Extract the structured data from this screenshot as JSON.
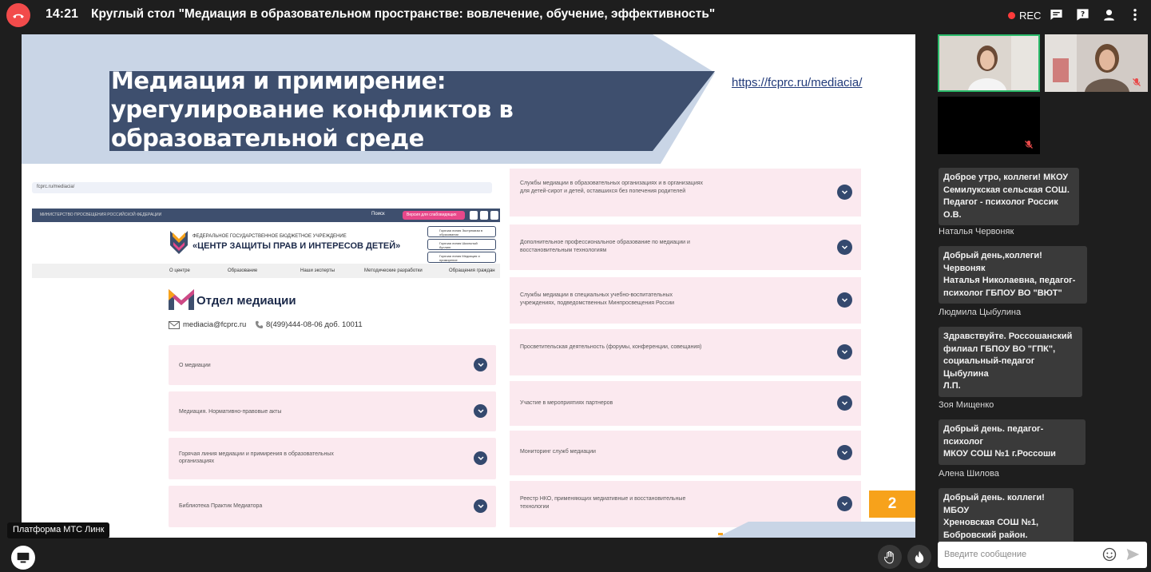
{
  "header": {
    "time": "14:21",
    "title": "Круглый стол \"Медиация в образовательном пространстве: вовлечение, обучение, эффективность\"",
    "rec_label": "REC"
  },
  "slide": {
    "heading_lines": [
      "Медиация и примирение:",
      "урегулирование конфликтов в",
      "образовательной среде"
    ],
    "link": "https://fcprc.ru/mediacia/",
    "page_number": "2",
    "site": {
      "url": "fcprc.ru/mediacia/",
      "nav_left": "МИНИСТЕРСТВО ПРОСВЕЩЕНИЯ РОССИЙСКОЙ ФЕДЕРАЦИИ",
      "search": "Поиск",
      "vision_button": "Версия для слабовидящих",
      "org_line1": "ФЕДЕРАЛЬНОЕ ГОСУДАРСТВЕННОЕ БЮДЖЕТНОЕ УЧРЕЖДЕНИЕ",
      "org_line2": "«ЦЕНТР ЗАЩИТЫ ПРАВ И ИНТЕРЕСОВ ДЕТЕЙ»",
      "hotlines": [
        "Горячая линия Экстремизм в образовании",
        "Горячая линия Школьный буллинг",
        "Горячая линия Медиация и примирение"
      ],
      "menu": [
        "О центре",
        "Образование",
        "Наши эксперты",
        "Методические разработки",
        "Обращения граждан"
      ],
      "dept_title": "Отдел медиации",
      "email": "mediacia@fcprc.ru",
      "phone": "8(499)444-08-06 доб. 10011",
      "left_items": [
        "О медиации",
        "Медиация. Нормативно-правовые акты",
        "Горячая линия медиации и примирения в образовательных организациях",
        "Библиотека Практик Медиатора"
      ],
      "right_items": [
        "Службы медиации в образовательных организациях и в организациях для детей-сирот и детей, оставшихся без попечения родителей",
        "Дополнительное профессиональное образование по медиации и восстановительным технологиям",
        "Службы медиации в специальных учебно-воспитательных учреждениях, подведомственных Минпросвещения России",
        "Просветительская деятельность (форумы, конференции, совещания)",
        "Участие в мероприятиях партнеров",
        "Мониторинг служб медиации",
        "Реестр НКО, применяющих медиативные и восстановительные технологии"
      ]
    }
  },
  "chat": {
    "messages": [
      {
        "author": "",
        "text_lines": [
          "Доброе утро, коллеги! МКОУ",
          "Семилукская сельская СОШ.",
          "Педагог - психолог Россик О.В."
        ]
      },
      {
        "author": "Наталья Червоняк",
        "text_lines": [
          "Добрый день,коллеги! Червоняк",
          "Наталья Николаевна, педагог-",
          "психолог ГБПОУ ВО \"ВЮТ\""
        ]
      },
      {
        "author": "Людмила Цыбулина",
        "text_lines": [
          "Здравствуйте. Россошанский",
          "филиал ГБПОУ ВО \"ГПК\",",
          "социальный-педагог Цыбулина",
          "Л.П."
        ]
      },
      {
        "author": "Зоя Мищенко",
        "text_lines": [
          "Добрый день. педагог-психолог",
          "МКОУ СОШ №1 г.Россоши"
        ]
      },
      {
        "author": "Алена Шилова",
        "text_lines": [
          "Добрый день. коллеги! МБОУ",
          "Хреновская СОШ №1,",
          "Бобровский район."
        ]
      }
    ],
    "input_placeholder": "Введите сообщение"
  },
  "footer": {
    "platform_label": "Платформа МТС Линк"
  },
  "colors": {
    "end_call": "#f24b4b",
    "rec_dot": "#ff3b3b",
    "banner": "#3e4f6e",
    "accent_orange": "#f7a21b",
    "active_speaker": "#2bba6a"
  }
}
